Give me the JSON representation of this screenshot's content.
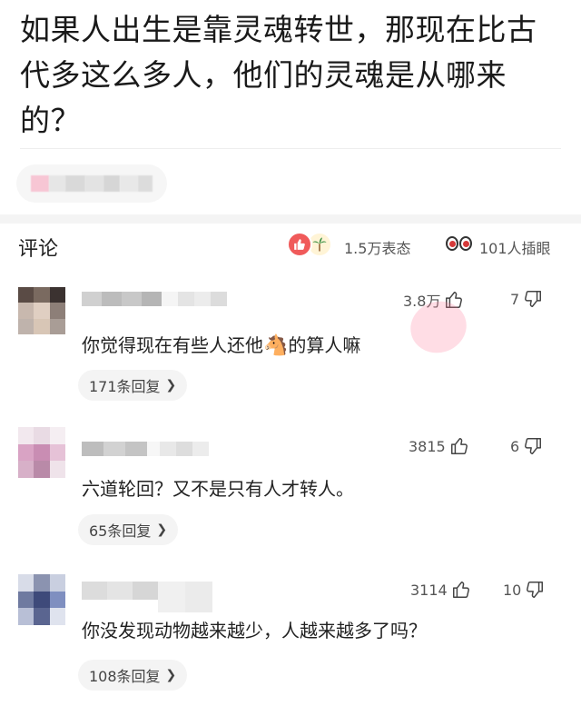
{
  "question": {
    "text": "如果人出生是靠灵魂转世，那现在比古代多这么多人，他们的灵魂是从哪来的？"
  },
  "comments_header": {
    "title": "评论",
    "reaction_count": "1.5万表态",
    "watch_count": "101人插眼"
  },
  "comments": [
    {
      "likes": "3.8万",
      "dislikes": "7",
      "text_before": "你觉得现在有些人还他",
      "emoji": "🐴",
      "text_after": "的算人嘛",
      "replies": "171条回复"
    },
    {
      "likes": "3815",
      "dislikes": "6",
      "text": "六道轮回？又不是只有人才转人。",
      "replies": "65条回复"
    },
    {
      "likes": "3114",
      "dislikes": "10",
      "text": "你没发现动物越来越少，人越来越多了吗？",
      "replies": "108条回复"
    }
  ],
  "colors": {
    "like_red": "#f05a5a",
    "eye_red": "#d63a3a",
    "pill_bg": "#f4f4f4",
    "band_bg": "#f4f4f4"
  },
  "icons": [
    "thumbs-up-icon",
    "thumbs-down-icon",
    "eyes-icon",
    "like-reaction-icon",
    "palm-tree-icon",
    "chevron-right-icon",
    "horse-emoji"
  ]
}
